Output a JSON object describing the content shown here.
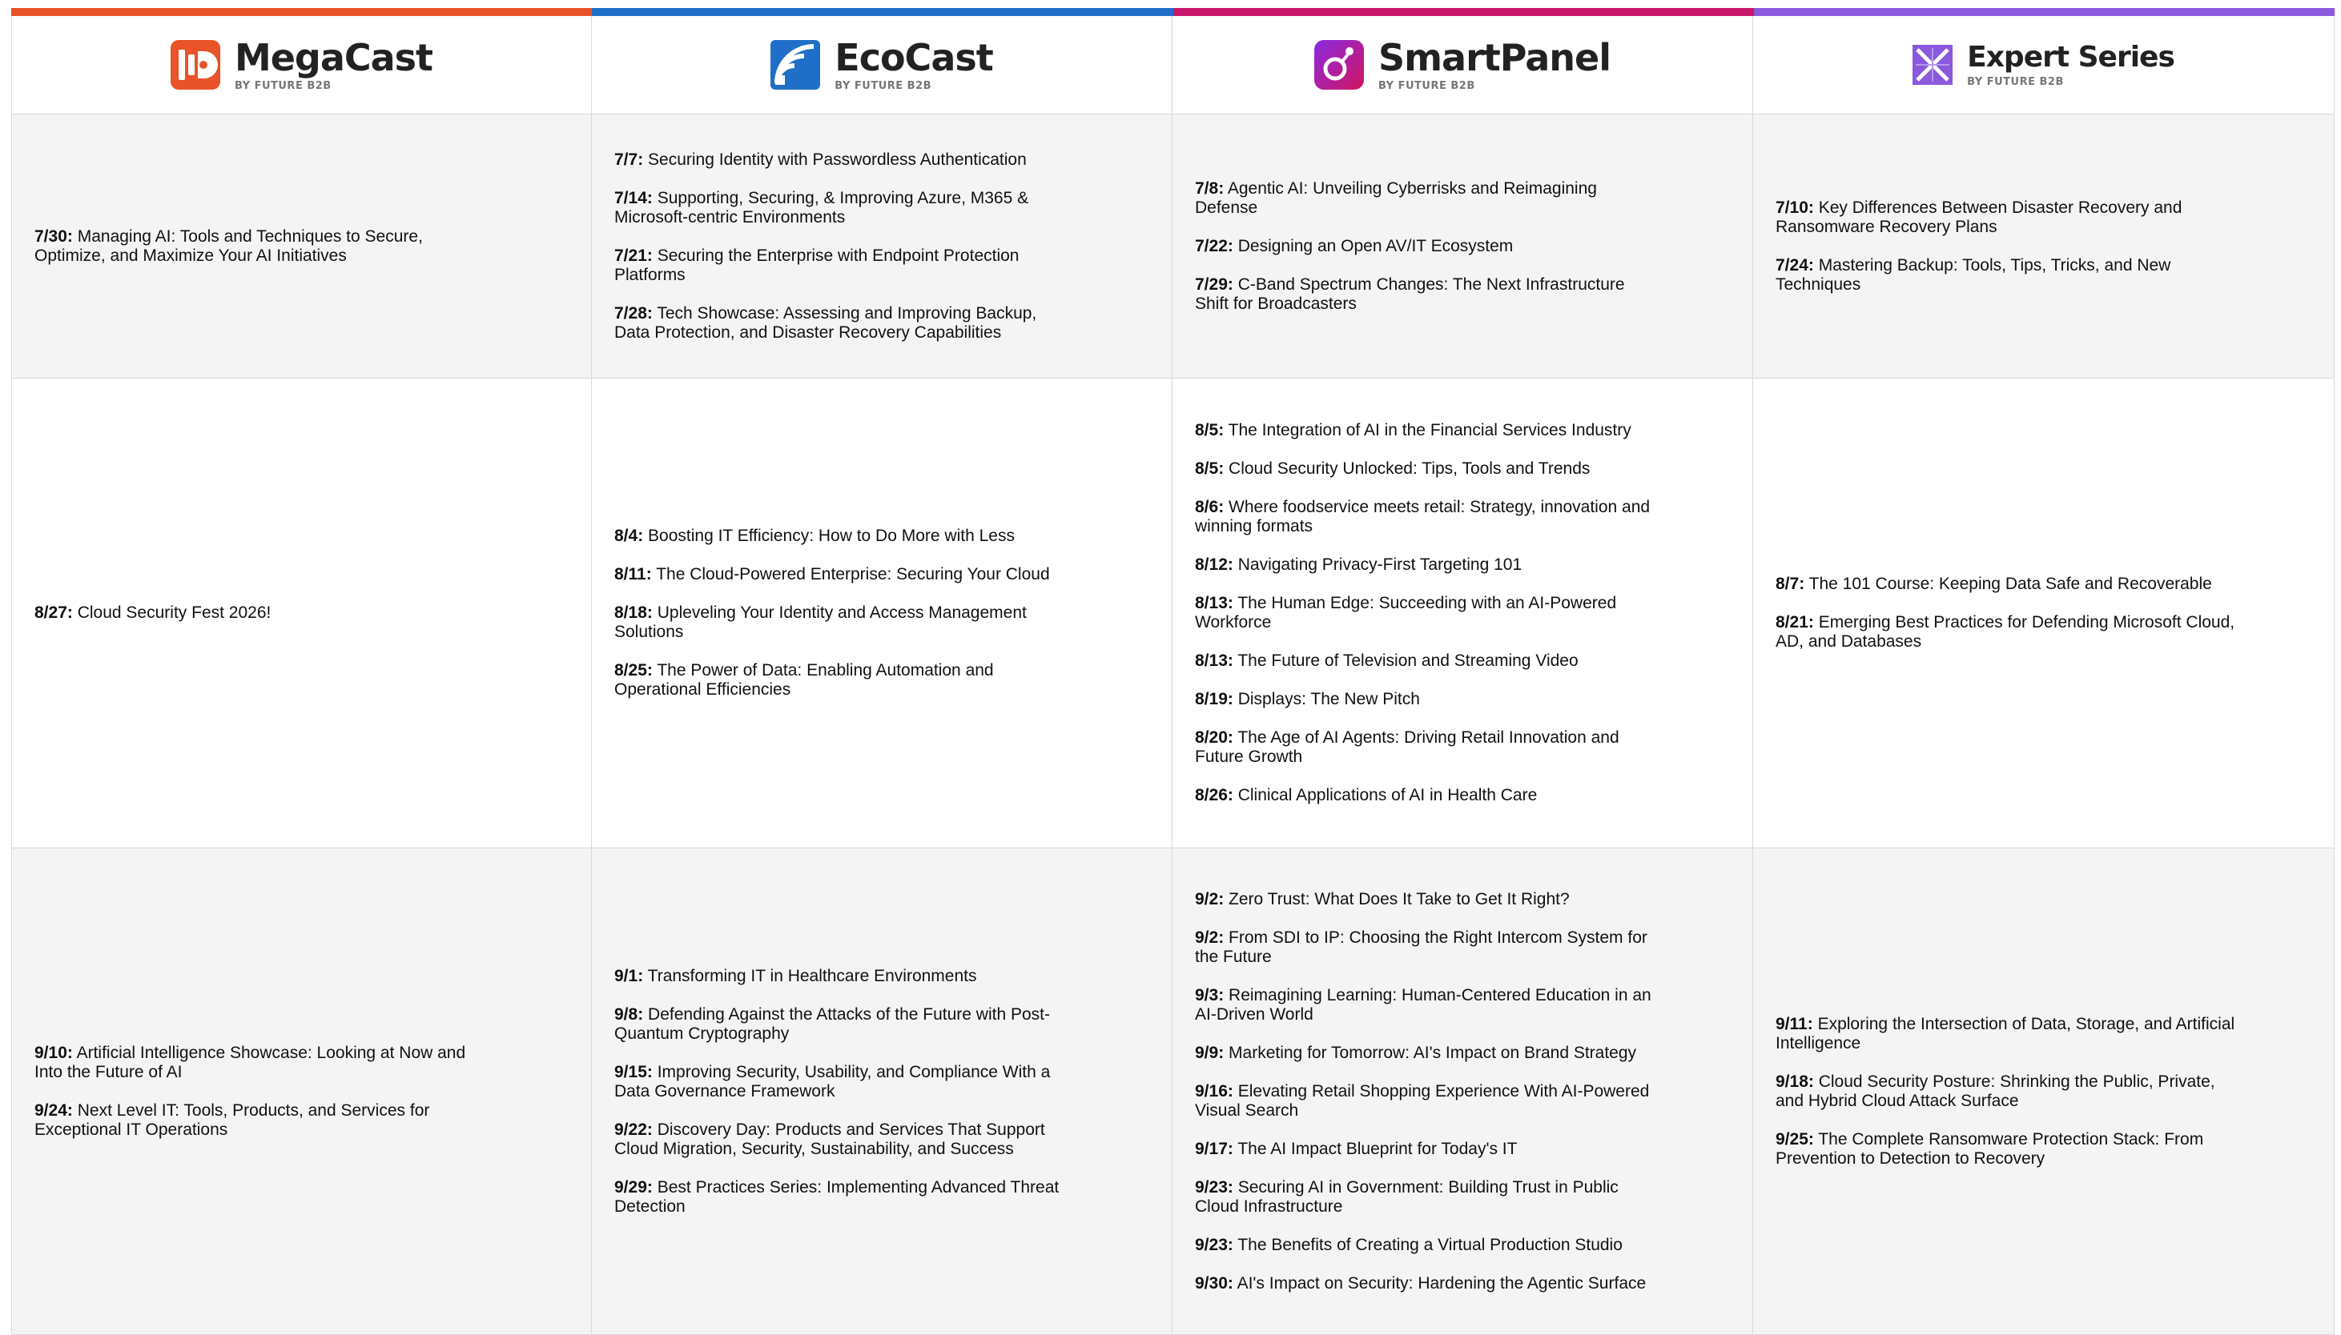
{
  "colors": {
    "megacast": "#e8532a",
    "ecocast": "#1f6fc9",
    "smartpanel": "#c8176a",
    "expert": "#8a59dd"
  },
  "brands": [
    {
      "id": "megacast",
      "name": "MegaCast",
      "sub": "BY FUTURE B2B",
      "icon": "megacast-logo-icon"
    },
    {
      "id": "ecocast",
      "name": "EcoCast",
      "sub": "BY FUTURE B2B",
      "icon": "ecocast-logo-icon"
    },
    {
      "id": "smartpanel",
      "name": "SmartPanel",
      "sub": "BY FUTURE B2B",
      "icon": "smartpanel-logo-icon"
    },
    {
      "id": "expert",
      "name": "Expert Series",
      "sub": "BY FUTURE B2B",
      "icon": "expert-series-logo-icon"
    }
  ],
  "rows": [
    [
      [
        {
          "date": "7/30:",
          "title": "Managing AI: Tools and Techniques to Secure, Optimize, and Maximize Your AI Initiatives"
        }
      ],
      [
        {
          "date": "7/7:",
          "title": "Securing Identity with Passwordless Authentication"
        },
        {
          "date": "7/14:",
          "title": "Supporting, Securing, & Improving Azure, M365 & Microsoft-centric Environments"
        },
        {
          "date": "7/21:",
          "title": "Securing the Enterprise with Endpoint Protection Platforms"
        },
        {
          "date": "7/28:",
          "title": "Tech Showcase: Assessing and Improving Backup, Data Protection, and Disaster Recovery Capabilities"
        }
      ],
      [
        {
          "date": "7/8:",
          "title": "Agentic AI: Unveiling Cyberrisks and Reimagining Defense"
        },
        {
          "date": "7/22:",
          "title": "Designing an Open AV/IT Ecosystem"
        },
        {
          "date": "7/29:",
          "title": "C-Band Spectrum Changes: The Next Infrastructure Shift for Broadcasters"
        }
      ],
      [
        {
          "date": "7/10:",
          "title": "Key Differences Between Disaster Recovery and Ransomware Recovery Plans"
        },
        {
          "date": "7/24:",
          "title": "Mastering Backup: Tools, Tips, Tricks, and New Techniques"
        }
      ]
    ],
    [
      [
        {
          "date": "8/27:",
          "title": "Cloud Security Fest 2026!"
        }
      ],
      [
        {
          "date": "8/4:",
          "title": "Boosting IT Efficiency: How to Do More with Less"
        },
        {
          "date": "8/11:",
          "title": "The Cloud-Powered Enterprise: Securing Your Cloud"
        },
        {
          "date": "8/18:",
          "title": "Upleveling Your Identity and Access Management Solutions"
        },
        {
          "date": "8/25:",
          "title": "The Power of Data: Enabling Automation and Operational Efficiencies"
        }
      ],
      [
        {
          "date": "8/5:",
          "title": "The Integration of AI in the Financial Services Industry"
        },
        {
          "date": "8/5:",
          "title": "Cloud Security Unlocked: Tips, Tools and Trends"
        },
        {
          "date": "8/6:",
          "title": "Where foodservice meets retail: Strategy, innovation and winning formats"
        },
        {
          "date": "8/12:",
          "title": "Navigating Privacy-First Targeting 101"
        },
        {
          "date": "8/13:",
          "title": "The Human Edge: Succeeding with an AI-Powered Workforce"
        },
        {
          "date": "8/13:",
          "title": "The Future of Television and Streaming Video"
        },
        {
          "date": "8/19:",
          "title": "Displays: The New Pitch"
        },
        {
          "date": "8/20:",
          "title": "The Age of AI Agents: Driving Retail Innovation and Future Growth"
        },
        {
          "date": "8/26:",
          "title": "Clinical Applications of AI in Health Care"
        }
      ],
      [
        {
          "date": "8/7:",
          "title": "The 101 Course: Keeping Data Safe and Recoverable"
        },
        {
          "date": "8/21:",
          "title": "Emerging Best Practices for Defending Microsoft Cloud, AD, and Databases"
        }
      ]
    ],
    [
      [
        {
          "date": "9/10:",
          "title": "Artificial Intelligence Showcase: Looking at Now and Into the Future of AI"
        },
        {
          "date": "9/24:",
          "title": "Next Level IT: Tools, Products, and Services for Exceptional IT Operations"
        }
      ],
      [
        {
          "date": "9/1:",
          "title": "Transforming IT in Healthcare Environments"
        },
        {
          "date": "9/8:",
          "title": "Defending Against the Attacks of the Future with Post-Quantum Cryptography"
        },
        {
          "date": "9/15:",
          "title": "Improving Security, Usability, and Compliance With a Data Governance Framework"
        },
        {
          "date": "9/22:",
          "title": "Discovery Day: Products and Services That Support Cloud Migration, Security, Sustainability, and Success"
        },
        {
          "date": "9/29:",
          "title": "Best Practices Series: Implementing Advanced Threat Detection"
        }
      ],
      [
        {
          "date": "9/2:",
          "title": "Zero Trust: What Does It Take to Get It Right?"
        },
        {
          "date": "9/2:",
          "title": "From SDI to IP: Choosing the Right Intercom System for the Future"
        },
        {
          "date": "9/3:",
          "title": "Reimagining Learning: Human-Centered Education in an AI-Driven World"
        },
        {
          "date": "9/9:",
          "title": "Marketing for Tomorrow: AI's Impact on Brand Strategy"
        },
        {
          "date": "9/16:",
          "title": "Elevating Retail Shopping Experience With AI-Powered Visual Search"
        },
        {
          "date": "9/17:",
          "title": "The AI Impact Blueprint for Today's IT"
        },
        {
          "date": "9/23:",
          "title": "Securing AI in Government: Building Trust in Public Cloud Infrastructure"
        },
        {
          "date": "9/23:",
          "title": "The Benefits of Creating a Virtual Production Studio"
        },
        {
          "date": "9/30:",
          "title": "AI's Impact on Security: Hardening the Agentic Surface"
        }
      ],
      [
        {
          "date": "9/11:",
          "title": "Exploring the Intersection of Data, Storage, and Artificial Intelligence"
        },
        {
          "date": "9/18:",
          "title": "Cloud Security Posture: Shrinking the Public, Private, and Hybrid Cloud Attack Surface"
        },
        {
          "date": "9/25:",
          "title": "The Complete Ransomware Protection Stack: From Prevention to Detection to Recovery"
        }
      ]
    ]
  ]
}
